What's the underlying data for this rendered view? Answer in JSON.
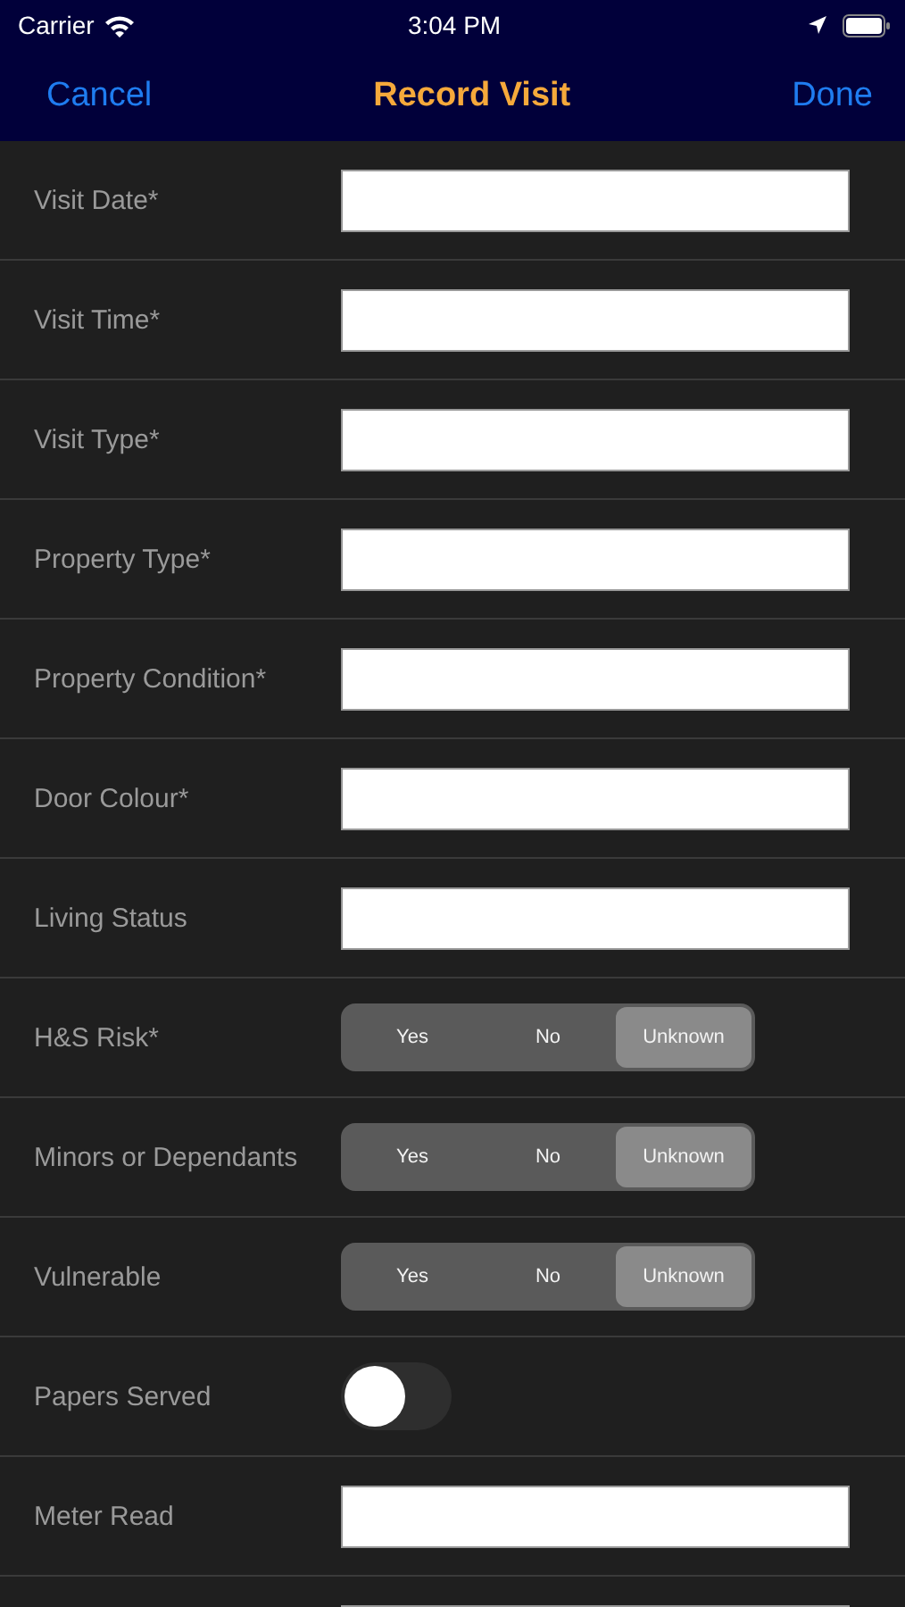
{
  "status_bar": {
    "carrier": "Carrier",
    "time": "3:04 PM"
  },
  "nav": {
    "cancel": "Cancel",
    "title": "Record Visit",
    "done": "Done"
  },
  "rows": [
    {
      "kind": "text",
      "label": "Visit Date*"
    },
    {
      "kind": "text",
      "label": "Visit Time*"
    },
    {
      "kind": "text",
      "label": "Visit Type*"
    },
    {
      "kind": "text",
      "label": "Property Type*"
    },
    {
      "kind": "text",
      "label": "Property Condition*"
    },
    {
      "kind": "text",
      "label": "Door Colour*"
    },
    {
      "kind": "text",
      "label": "Living Status"
    },
    {
      "kind": "segmented",
      "label": "H&S Risk*",
      "options": [
        {
          "label": "Yes",
          "selected": false
        },
        {
          "label": "No",
          "selected": false
        },
        {
          "label": "Unknown",
          "selected": true
        }
      ]
    },
    {
      "kind": "segmented",
      "label": "Minors or Dependants",
      "options": [
        {
          "label": "Yes",
          "selected": false
        },
        {
          "label": "No",
          "selected": false
        },
        {
          "label": "Unknown",
          "selected": true
        }
      ]
    },
    {
      "kind": "segmented",
      "label": "Vulnerable",
      "options": [
        {
          "label": "Yes",
          "selected": false
        },
        {
          "label": "No",
          "selected": false
        },
        {
          "label": "Unknown",
          "selected": true
        }
      ]
    },
    {
      "kind": "toggle",
      "label": "Papers Served",
      "on": false
    },
    {
      "kind": "text",
      "label": "Meter Read"
    },
    {
      "kind": "text"
    }
  ]
}
